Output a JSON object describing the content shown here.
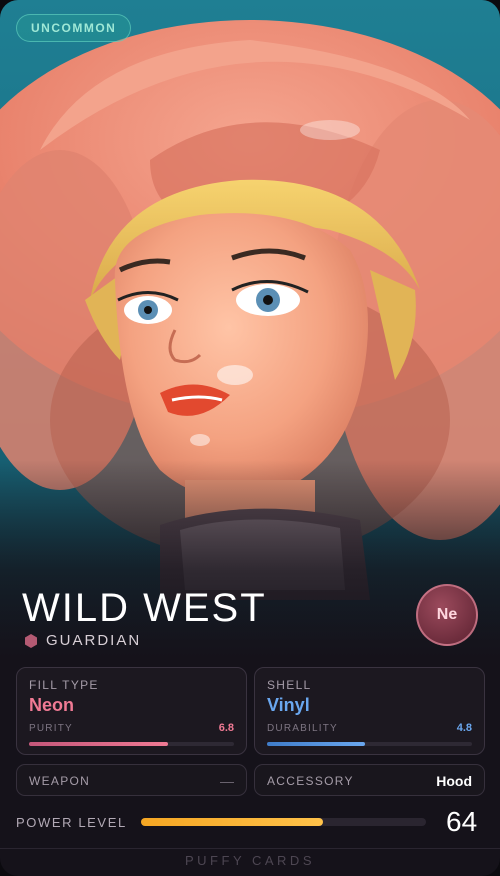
{
  "card": {
    "rarity": "UNCOMMON",
    "name": "WILD WEST",
    "class": "GUARDIAN",
    "element_badge": "Ne",
    "art_description_icon": "doll-cowboy-hat-artwork"
  },
  "stats": {
    "fill": {
      "label": "FILL TYPE",
      "value": "Neon",
      "sub_label": "PURITY",
      "score": "6.8",
      "level": 0.68,
      "color": "#f07a94"
    },
    "shell": {
      "label": "SHELL",
      "value": "Vinyl",
      "sub_label": "DURABILITY",
      "score": "4.8",
      "level": 0.48,
      "color": "#6aa7ef"
    }
  },
  "equipment": {
    "weapon": {
      "label": "WEAPON",
      "value": "—"
    },
    "accessory": {
      "label": "ACCESSORY",
      "value": "Hood"
    }
  },
  "power": {
    "label": "POWER LEVEL",
    "value": "64",
    "level": 0.64
  },
  "footer": "PUFFY CARDS",
  "colors": {
    "accent_pink": "#f07a94",
    "accent_blue": "#6aa7ef",
    "power_gold": "#f5a623",
    "rarity_teal": "#9fe8d6"
  }
}
